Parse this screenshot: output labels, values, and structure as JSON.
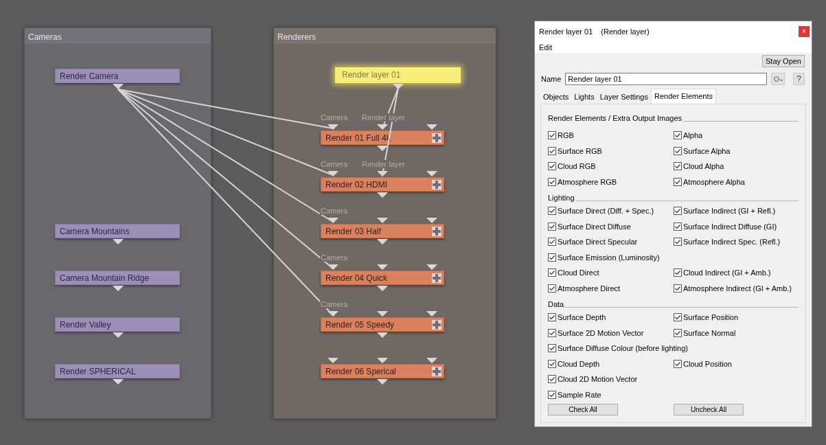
{
  "cameras_panel": {
    "title": "Cameras",
    "nodes": [
      {
        "label": "Render Camera"
      },
      {
        "label": "Camera Mountains"
      },
      {
        "label": "Camera Mountain Ridge"
      },
      {
        "label": "Render Valley"
      },
      {
        "label": "Render SPHERICAL"
      }
    ]
  },
  "renderers_panel": {
    "title": "Renderers",
    "layer_node": {
      "label": "Render layer 01",
      "selected": true
    },
    "nodes": [
      {
        "label": "Render 01 Full 4k",
        "input_labels": [
          "Camera",
          "Render layer"
        ],
        "camera_linked": true,
        "layer_linked": true
      },
      {
        "label": "Render 02 HDMI",
        "input_labels": [
          "Camera",
          "Render layer"
        ],
        "camera_linked": true,
        "layer_linked": true
      },
      {
        "label": "Render 03 Half",
        "input_labels": [
          "Camera"
        ],
        "camera_linked": true,
        "layer_linked": false
      },
      {
        "label": "Render 04 Quick",
        "input_labels": [
          "Camera"
        ],
        "camera_linked": true,
        "layer_linked": false
      },
      {
        "label": "Render 05 Speedy",
        "input_labels": [
          "Camera"
        ],
        "camera_linked": true,
        "layer_linked": false
      },
      {
        "label": "Render 06 Sperical",
        "camera_linked": false,
        "layer_linked": false
      }
    ]
  },
  "dialog": {
    "title": "Render layer 01",
    "subtitle": "(Render layer)",
    "close": "×",
    "menu": [
      "Edit"
    ],
    "stay_open_button": "Stay Open",
    "name_label": "Name",
    "name_value": "Render layer 01",
    "help_button": "?",
    "tabs": [
      {
        "label": "Objects",
        "selected": false
      },
      {
        "label": "Lights",
        "selected": false
      },
      {
        "label": "Layer Settings",
        "selected": false
      },
      {
        "label": "Render Elements",
        "selected": true
      }
    ],
    "sections": [
      {
        "title": "Render Elements / Extra Output Images",
        "rows": [
          [
            {
              "label": "RGB",
              "checked": true
            },
            {
              "label": "Alpha",
              "checked": true
            }
          ],
          [
            {
              "label": "Surface RGB",
              "checked": true
            },
            {
              "label": "Surface Alpha",
              "checked": true
            }
          ],
          [
            {
              "label": "Cloud RGB",
              "checked": true
            },
            {
              "label": "Cloud Alpha",
              "checked": true
            }
          ],
          [
            {
              "label": "Atmosphere RGB",
              "checked": true
            },
            {
              "label": "Atmosphere Alpha",
              "checked": true
            }
          ]
        ]
      },
      {
        "title": "Lighting",
        "rows": [
          [
            {
              "label": "Surface Direct (Diff. + Spec.)",
              "checked": true
            },
            {
              "label": "Surface Indirect (GI + Refl.)",
              "checked": true
            }
          ],
          [
            {
              "label": "Surface Direct Diffuse",
              "checked": true
            },
            {
              "label": "Surface Indirect Diffuse (GI)",
              "checked": true
            }
          ],
          [
            {
              "label": "Surface Direct Specular",
              "checked": true
            },
            {
              "label": "Surface Indirect Spec. (Refl.)",
              "checked": true
            }
          ],
          [
            {
              "label": "Surface Emission (Luminosity)",
              "checked": true
            }
          ],
          [
            {
              "label": "Cloud Direct",
              "checked": true
            },
            {
              "label": "Cloud Indirect (GI + Amb.)",
              "checked": true
            }
          ],
          [
            {
              "label": "Atmosphere Direct",
              "checked": true
            },
            {
              "label": "Atmosphere Indirect (GI + Amb.)",
              "checked": true
            }
          ]
        ]
      },
      {
        "title": "Data",
        "rows": [
          [
            {
              "label": "Surface Depth",
              "checked": true
            },
            {
              "label": "Surface Position",
              "checked": true
            }
          ],
          [
            {
              "label": "Surface 2D Motion Vector",
              "checked": true
            },
            {
              "label": "Surface Normal",
              "checked": true
            }
          ],
          [
            {
              "label": "Surface Diffuse Colour (before lighting)",
              "checked": true
            }
          ],
          [
            {
              "label": "Cloud Depth",
              "checked": true
            },
            {
              "label": "Cloud Position",
              "checked": true
            }
          ],
          [
            {
              "label": "Cloud 2D Motion Vector",
              "checked": true
            }
          ],
          [
            {
              "label": "Sample Rate",
              "checked": true
            }
          ]
        ]
      }
    ],
    "buttons": [
      "Check All",
      "Uncheck All"
    ]
  }
}
